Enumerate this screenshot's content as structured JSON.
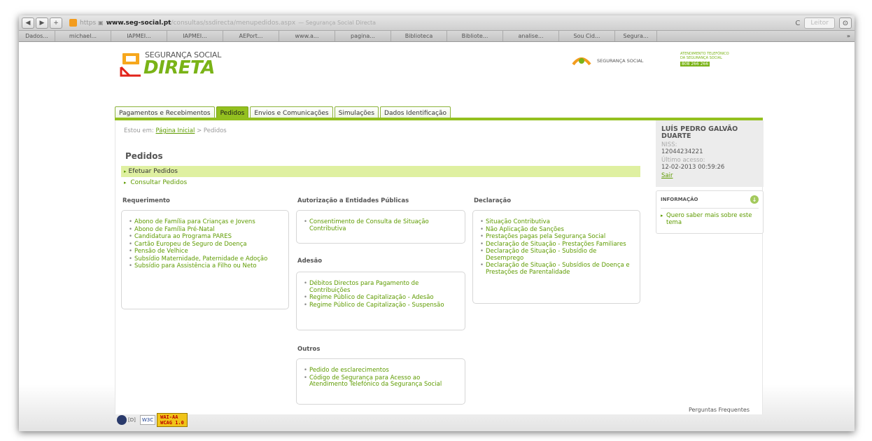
{
  "browser": {
    "url_protocol": "https",
    "url_host": "www.seg-social.pt",
    "url_path": "/consultas/ssdirecta/menupedidos.aspx",
    "page_title": "— Segurança Social Directa",
    "reader_label": "Leitor",
    "bookmarks": [
      "Dados...",
      "michael...",
      "IAPMEI...",
      "IAPMEI...",
      "AEPort...",
      "www.a...",
      "pagina...",
      "Biblioteca",
      "Bibliote...",
      "analise...",
      "Sou Cid...",
      "Segura..."
    ],
    "more_label": "»"
  },
  "header": {
    "logo_top": "SEGURANÇA SOCIAL",
    "logo_main": "DIRETA",
    "brand_text": "SEGURANÇA SOCIAL",
    "atendimento_line1": "ATENDIMENTO TELEFÓNICO",
    "atendimento_line2": "DA SEGURANÇA SOCIAL",
    "atendimento_phone": "808 266 266"
  },
  "tabs": [
    {
      "label": "Pagamentos e Recebimentos",
      "active": false
    },
    {
      "label": "Pedidos",
      "active": true
    },
    {
      "label": "Envios e Comunicações",
      "active": false
    },
    {
      "label": "Simulações",
      "active": false
    },
    {
      "label": "Dados Identificação",
      "active": false
    }
  ],
  "breadcrumb": {
    "prefix": "Estou em:",
    "home": "Página Inicial",
    "separator": ">",
    "current": "Pedidos"
  },
  "page_title": "Pedidos",
  "actions": {
    "efetuar": "Efetuar Pedidos",
    "consultar": "Consultar Pedidos"
  },
  "sections": {
    "requerimento": {
      "title": "Requerimento",
      "items": [
        "Abono de Família para Crianças e Jovens",
        "Abono de Família Pré-Natal",
        "Candidatura ao Programa PARES",
        "Cartão Europeu de Seguro de Doença",
        "Pensão de Velhice",
        "Subsídio Maternidade, Paternidade e Adoção",
        "Subsídio para Assistência a Filho ou Neto"
      ]
    },
    "autorizacao": {
      "title": "Autorização a Entidades Públicas",
      "items": [
        "Consentimento de Consulta de Situação Contributiva"
      ]
    },
    "adesao": {
      "title": "Adesão",
      "items": [
        "Débitos Directos para Pagamento de Contribuições",
        "Regime Público de Capitalização - Adesão",
        "Regime Público de Capitalização - Suspensão"
      ]
    },
    "outros": {
      "title": "Outros",
      "items": [
        "Pedido de esclarecimentos",
        "Código de Segurança para Acesso ao Atendimento Telefónico da Segurança Social"
      ]
    },
    "declaracao": {
      "title": "Declaração",
      "items": [
        "Situação Contributiva",
        "Não Aplicação de Sanções",
        "Prestações pagas pela Segurança Social",
        "Declaração de Situação - Prestações Familiares",
        "Declaração de Situação - Subsídio de Desemprego",
        "Declaração de Situação - Subsídios de Doença e Prestações de Parentalidade"
      ]
    }
  },
  "user": {
    "name": "LUÍS PEDRO GALVÃO DUARTE",
    "niss_label": "NISS:",
    "niss": "12044234221",
    "last_access_label": "Último acesso:",
    "last_access": "12-02-2013 00:59:26",
    "logout": "Sair"
  },
  "info": {
    "title": "INFORMAÇÃO",
    "link": "Quero saber mais sobre este tema"
  },
  "footer": {
    "d_link": "[D]",
    "w3c": "W3C",
    "wai_line1": "WAI-AA",
    "wai_line2": "WCAG 1.0",
    "faq": "Perguntas Frequentes"
  },
  "colors": {
    "accent_green": "#93c01f",
    "link_green": "#5e9b00",
    "highlight": "#dff0a1"
  }
}
